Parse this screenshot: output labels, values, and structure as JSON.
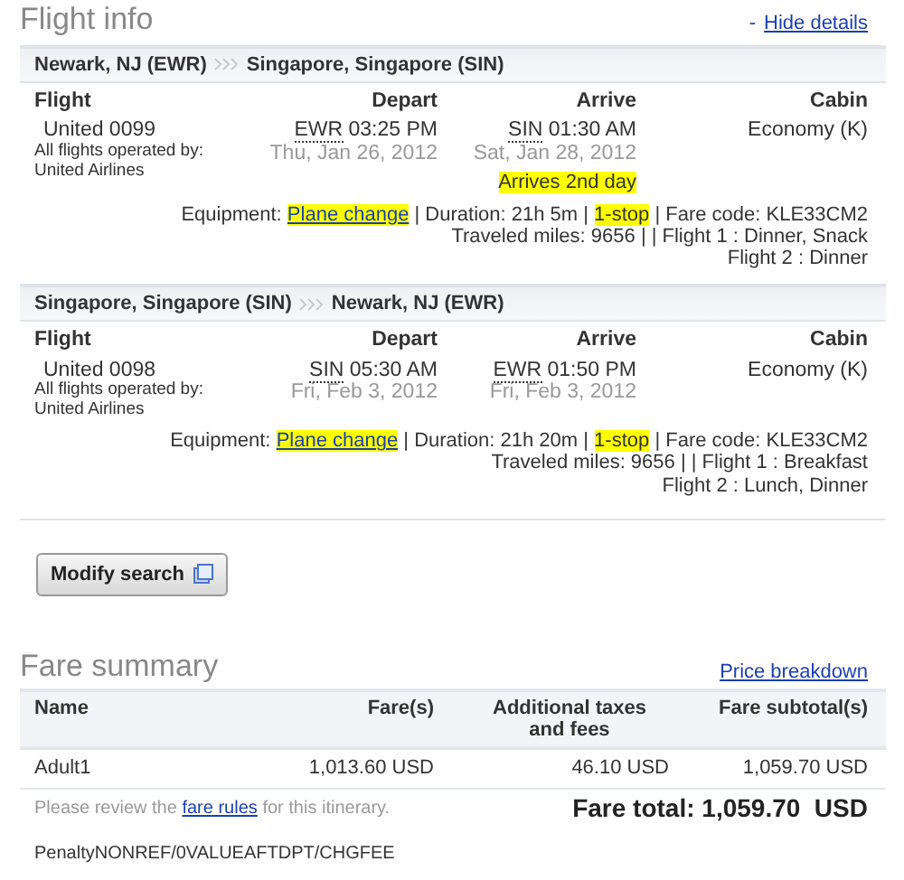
{
  "flight_info": {
    "title": "Flight info",
    "toggle_prefix": "-",
    "toggle_link": "Hide details",
    "trips": [
      {
        "columns": [
          "Flight",
          "Depart",
          "Arrive",
          "Cabin"
        ],
        "route_from": "Newark, NJ (EWR)",
        "route_to": "Singapore, Singapore (SIN)",
        "flight": "United 0099",
        "operated_by": "All flights operated by:",
        "operator": "United Airlines",
        "depart_code": "EWR",
        "depart_time": "03:25 PM",
        "depart_date": "Thu, Jan 26, 2012",
        "arrive_code": "SIN",
        "arrive_time": "01:30 AM",
        "arrive_date": "Sat, Jan 28, 2012",
        "arrival_note": "Arrives 2nd day",
        "cabin": "Economy (K)",
        "equipment_label": "Equipment:",
        "equipment_link": "Plane change",
        "duration": "| Duration: 21h 5m |",
        "stops": "1-stop",
        "fare_code": "| Fare code: KLE33CM2",
        "miles_line": "Traveled miles: 9656 | | Flight 1 : Dinner, Snack",
        "meal_line": "Flight 2 : Dinner"
      },
      {
        "columns": [
          "Flight",
          "Depart",
          "Arrive",
          "Cabin"
        ],
        "route_from": "Singapore, Singapore (SIN)",
        "route_to": "Newark, NJ (EWR)",
        "flight": "United 0098",
        "operated_by": "All flights operated by:",
        "operator": "United Airlines",
        "depart_code": "SIN",
        "depart_time": "05:30 AM",
        "depart_date": "Fri, Feb 3, 2012",
        "arrive_code": "EWR",
        "arrive_time": "01:50 PM",
        "arrive_date": "Fri, Feb 3, 2012",
        "cabin": "Economy (K)",
        "equipment_label": "Equipment:",
        "equipment_link": "Plane change",
        "duration": "| Duration: 21h 20m |",
        "stops": "1-stop",
        "fare_code": "| Fare code: KLE33CM2",
        "miles_line": "Traveled miles: 9656 | | Flight 1 : Breakfast",
        "meal_line": "Flight 2 : Lunch, Dinner"
      }
    ]
  },
  "modify_button": "Modify search",
  "fare_summary": {
    "title": "Fare summary",
    "link": "Price breakdown",
    "columns": [
      "Name",
      "Fare(s)",
      "Additional taxes and fees",
      "Fare subtotal(s)"
    ],
    "rows": [
      [
        "Adult1",
        "1,013.60 USD",
        "46.10 USD",
        "1,059.70 USD"
      ]
    ],
    "note_before": "Please review the",
    "note_link": "fare rules",
    "note_after": "for this itinerary.",
    "total": "Fare total: 1,059.70  USD",
    "penalty": "PenaltyNONREF/0VALUEAFTDPT/CHGFEE"
  }
}
